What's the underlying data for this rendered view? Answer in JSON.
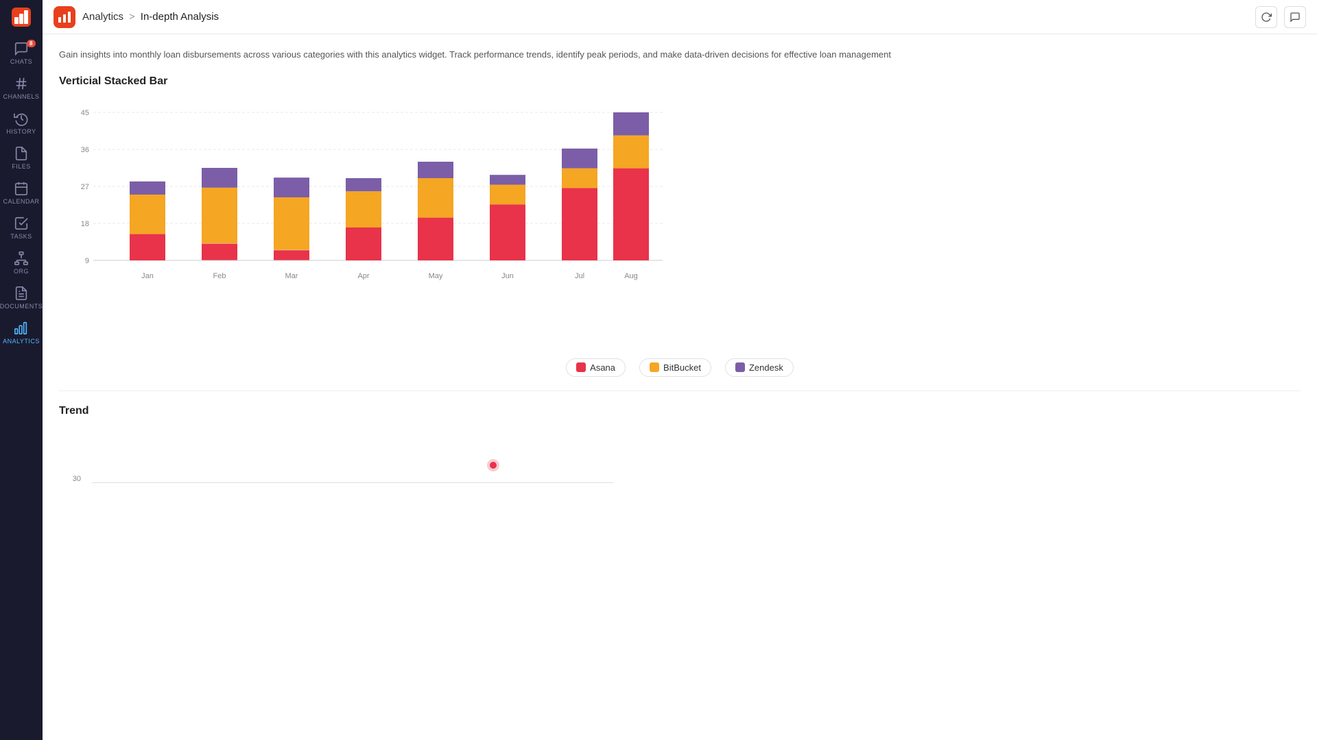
{
  "sidebar": {
    "items": [
      {
        "id": "chats",
        "label": "CHATS",
        "icon": "chat",
        "badge": "8",
        "active": false
      },
      {
        "id": "channels",
        "label": "CHANNELS",
        "icon": "hash",
        "badge": null,
        "active": false
      },
      {
        "id": "history",
        "label": "HISTORY",
        "icon": "clock",
        "badge": null,
        "active": false
      },
      {
        "id": "files",
        "label": "FILES",
        "icon": "file",
        "badge": null,
        "active": false
      },
      {
        "id": "calendar",
        "label": "CALENDAR",
        "icon": "calendar",
        "badge": null,
        "active": false
      },
      {
        "id": "tasks",
        "label": "TASKS",
        "icon": "check-square",
        "badge": null,
        "active": false
      },
      {
        "id": "org",
        "label": "ORG",
        "icon": "org",
        "badge": null,
        "active": false
      },
      {
        "id": "documents",
        "label": "DOCUMENTS",
        "icon": "document",
        "badge": null,
        "active": false
      },
      {
        "id": "analytics",
        "label": "ANALYTICS",
        "icon": "analytics",
        "badge": null,
        "active": true
      }
    ]
  },
  "header": {
    "app_name": "Analytics",
    "breadcrumb_sep": ">",
    "page_title": "In-depth Analysis",
    "refresh_title": "Refresh",
    "chat_title": "Chat"
  },
  "description": "Gain insights into monthly loan disbursements across various categories with this analytics widget. Track performance trends, identify peak periods, and make data-driven decisions for effective loan management",
  "stacked_bar": {
    "title": "Verticial Stacked Bar",
    "y_labels": [
      "9",
      "18",
      "27",
      "36",
      "45"
    ],
    "x_labels": [
      "Jan",
      "Feb",
      "Mar",
      "Apr",
      "May",
      "Jun",
      "Jul",
      "Aug"
    ],
    "max_value": 45,
    "data": {
      "Jan": {
        "asana": 8,
        "bitbucket": 12,
        "zendesk": 4
      },
      "Feb": {
        "asana": 5,
        "bitbucket": 17,
        "zendesk": 6
      },
      "Mar": {
        "asana": 3,
        "bitbucket": 16,
        "zendesk": 6
      },
      "Apr": {
        "asana": 10,
        "bitbucket": 11,
        "zendesk": 4
      },
      "May": {
        "asana": 13,
        "bitbucket": 12,
        "zendesk": 5
      },
      "Jun": {
        "asana": 17,
        "bitbucket": 6,
        "zendesk": 3
      },
      "Jul": {
        "asana": 22,
        "bitbucket": 6,
        "zendesk": 6
      },
      "Aug": {
        "asana": 28,
        "bitbucket": 10,
        "zendesk": 7
      }
    },
    "legend": [
      {
        "id": "asana",
        "label": "Asana",
        "color": "asana"
      },
      {
        "id": "bitbucket",
        "label": "BitBucket",
        "color": "bitbucket"
      },
      {
        "id": "zendesk",
        "label": "Zendesk",
        "color": "zendesk"
      }
    ]
  },
  "trend": {
    "title": "Trend",
    "y_label": "30"
  }
}
